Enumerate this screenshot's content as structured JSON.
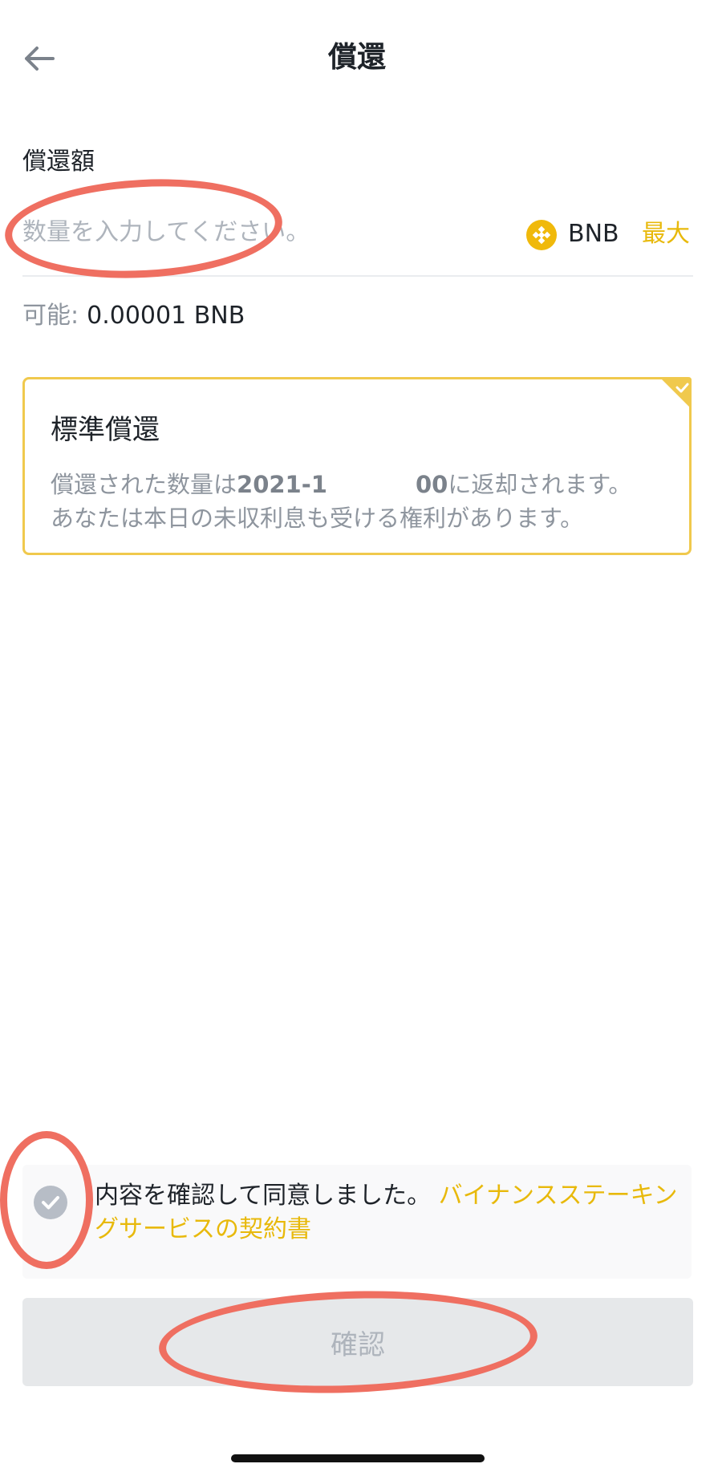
{
  "header": {
    "title": "償還",
    "back_icon": "arrow-left-icon"
  },
  "redeem": {
    "label": "償還額",
    "input_value": "",
    "input_placeholder": "数量を入力してください。",
    "asset": "BNB",
    "asset_icon": "bnb-coin-icon",
    "max_label": "最大"
  },
  "available": {
    "label": "可能:",
    "value": "0.00001  BNB"
  },
  "standard_redemption": {
    "title": "標準償還",
    "desc_prefix": "償還された数量は",
    "desc_date_start": "2021-1",
    "desc_date_end": "00",
    "desc_suffix": "に返却されます。",
    "desc_line2": "あなたは本日の未収利息も受ける権利があります。",
    "selected": true
  },
  "agreement": {
    "checked": false,
    "text": "内容を確認して同意しました。",
    "link_text": "バイナンスステーキングサービスの契約書"
  },
  "confirm": {
    "label": "確認",
    "enabled": false
  },
  "colors": {
    "accent": "#e8b90b",
    "card_border": "#f0c94d",
    "annotation": "#ef6f61",
    "muted_text": "#8e959e",
    "disabled_bg": "#e6e8ea"
  }
}
